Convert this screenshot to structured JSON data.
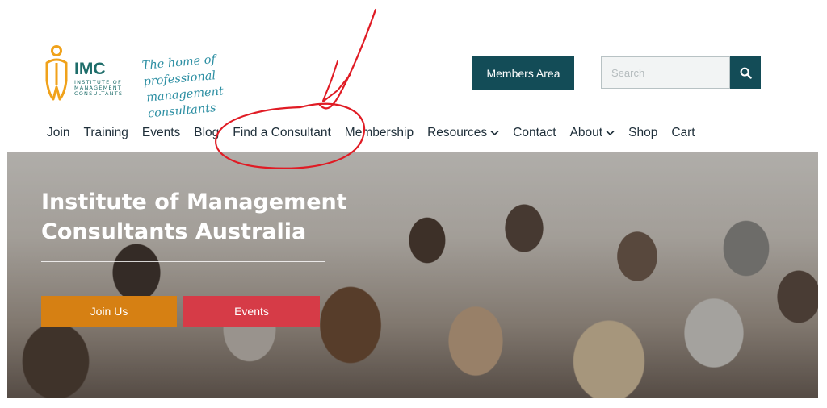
{
  "header": {
    "logo": {
      "acronym": "IMC",
      "name_lines": [
        "Institute of",
        "Management",
        "Consultants"
      ]
    },
    "tagline_lines": [
      "The home of professional",
      "management consultants"
    ],
    "members_area_label": "Members Area",
    "search": {
      "placeholder": "Search",
      "icon": "search-icon"
    }
  },
  "nav": {
    "items": [
      {
        "label": "Join"
      },
      {
        "label": "Training"
      },
      {
        "label": "Events"
      },
      {
        "label": "Blog"
      },
      {
        "label": "Find a Consultant"
      },
      {
        "label": "Membership"
      },
      {
        "label": "Resources",
        "has_dropdown": true
      },
      {
        "label": "Contact"
      },
      {
        "label": "About",
        "has_dropdown": true
      },
      {
        "label": "Shop"
      },
      {
        "label": "Cart"
      }
    ]
  },
  "hero": {
    "title_lines": [
      "Institute of Management",
      "Consultants Australia"
    ],
    "join_label": "Join Us",
    "events_label": "Events"
  },
  "colors": {
    "brand_teal": "#1e6d6a",
    "logo_orange": "#f0a21b",
    "button_dark": "#134c57",
    "join_orange": "#d68013",
    "events_red": "#d63b47",
    "annotation_red": "#e01b24"
  }
}
